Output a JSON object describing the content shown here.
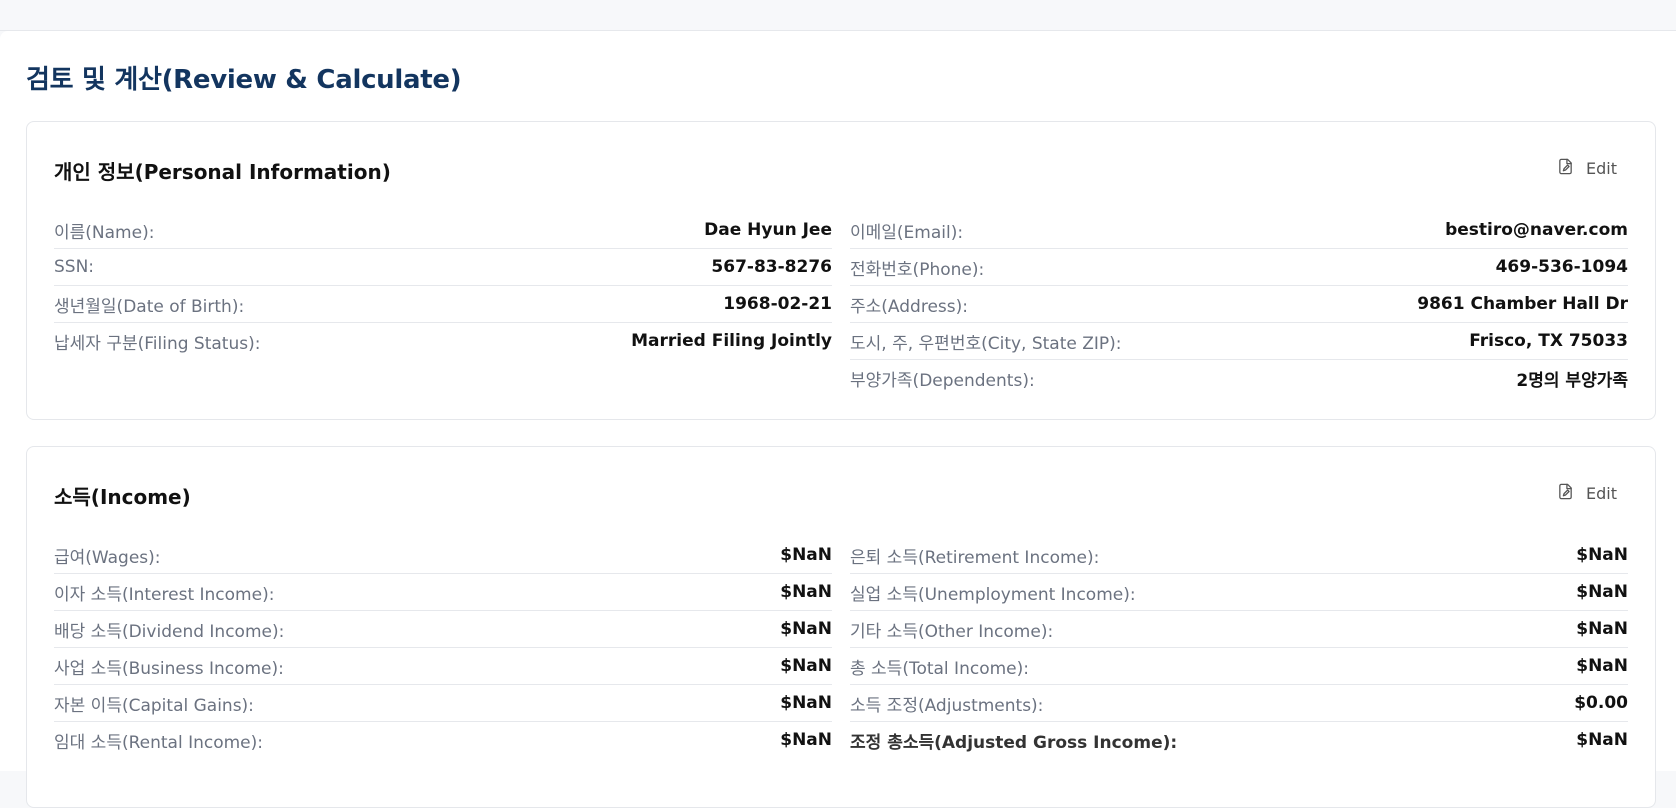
{
  "page": {
    "title": "검토 및 계산(Review & Calculate)"
  },
  "personal": {
    "title": "개인 정보(Personal Information)",
    "edit_label": "Edit",
    "left": [
      {
        "label": "이름(Name):",
        "value": "Dae Hyun Jee"
      },
      {
        "label": "SSN:",
        "value": "567-83-8276"
      },
      {
        "label": "생년월일(Date of Birth):",
        "value": "1968-02-21"
      },
      {
        "label": "납세자 구분(Filing Status):",
        "value": "Married Filing Jointly"
      }
    ],
    "right": [
      {
        "label": "이메일(Email):",
        "value": "bestiro@naver.com"
      },
      {
        "label": "전화번호(Phone):",
        "value": "469-536-1094"
      },
      {
        "label": "주소(Address):",
        "value": "9861 Chamber Hall Dr"
      },
      {
        "label": "도시, 주, 우편번호(City, State ZIP):",
        "value": "Frisco, TX 75033"
      },
      {
        "label": "부양가족(Dependents):",
        "value": "2명의 부양가족"
      }
    ]
  },
  "income": {
    "title": "소득(Income)",
    "edit_label": "Edit",
    "left": [
      {
        "label": "급여(Wages):",
        "value": "$NaN"
      },
      {
        "label": "이자 소득(Interest Income):",
        "value": "$NaN"
      },
      {
        "label": "배당 소득(Dividend Income):",
        "value": "$NaN"
      },
      {
        "label": "사업 소득(Business Income):",
        "value": "$NaN"
      },
      {
        "label": "자본 이득(Capital Gains):",
        "value": "$NaN"
      },
      {
        "label": "임대 소득(Rental Income):",
        "value": "$NaN"
      }
    ],
    "right": [
      {
        "label": "은퇴 소득(Retirement Income):",
        "value": "$NaN"
      },
      {
        "label": "실업 소득(Unemployment Income):",
        "value": "$NaN"
      },
      {
        "label": "기타 소득(Other Income):",
        "value": "$NaN"
      },
      {
        "label": "총 소득(Total Income):",
        "value": "$NaN"
      },
      {
        "label": "소득 조정(Adjustments):",
        "value": "$0.00"
      },
      {
        "label": "조정 총소득(Adjusted Gross Income):",
        "value": "$NaN"
      }
    ]
  },
  "icons": {
    "edit": "edit-document-icon"
  }
}
